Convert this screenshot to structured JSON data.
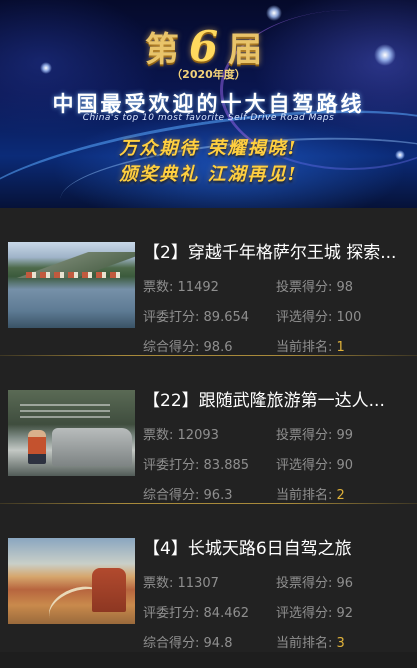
{
  "banner": {
    "edition_prefix": "第",
    "edition_number": "6",
    "edition_suffix": "届",
    "year": "（2020年度）",
    "title_cn": "中国最受欢迎的十大自驾路线",
    "title_en": "China's top 10 most favorite Self-Drive Road Maps",
    "slogan_line1": "万众期待 荣耀揭晓!",
    "slogan_line2": "颁奖典礼 江湖再见!"
  },
  "labels": {
    "votes": "票数:",
    "vote_score": "投票得分:",
    "jury_score": "评委打分:",
    "selection_score": "评选得分:",
    "total_score": "综合得分:",
    "current_rank": "当前排名:"
  },
  "items": [
    {
      "title": "【2】穿越千年格萨尔王城 探索...",
      "votes": "11492",
      "vote_score": "98",
      "jury_score": "89.654",
      "selection_score": "100",
      "total_score": "98.6",
      "rank": "1"
    },
    {
      "title": "【22】跟随武隆旅游第一达人...",
      "votes": "12093",
      "vote_score": "99",
      "jury_score": "83.885",
      "selection_score": "90",
      "total_score": "96.3",
      "rank": "2"
    },
    {
      "title": "【4】长城天路6日自驾之旅",
      "votes": "11307",
      "vote_score": "96",
      "jury_score": "84.462",
      "selection_score": "92",
      "total_score": "94.8",
      "rank": "3"
    }
  ],
  "colors": {
    "background": "#222222",
    "rank_accent": "#e0b23a",
    "divider": "#a88a3b",
    "muted_text": "#8f8f8f"
  }
}
